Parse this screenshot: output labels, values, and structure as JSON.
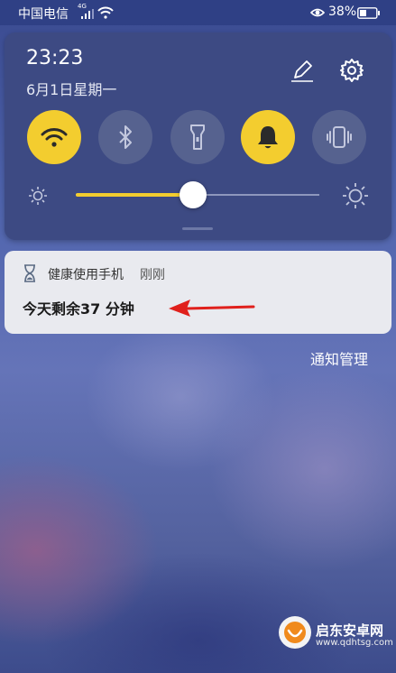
{
  "status_bar": {
    "carrier": "中国电信",
    "network_badge": "4G",
    "battery": "38%",
    "icons": [
      "signal-icon",
      "wifi-icon",
      "eye-comfort-icon",
      "battery-icon"
    ]
  },
  "quick_panel": {
    "time": "23:23",
    "date": "6月1日星期一",
    "toggles": [
      {
        "name": "wifi",
        "icon": "wifi-icon",
        "state": "on"
      },
      {
        "name": "bluetooth",
        "icon": "bluetooth-icon",
        "state": "off"
      },
      {
        "name": "flashlight",
        "icon": "flashlight-icon",
        "state": "off"
      },
      {
        "name": "sound",
        "icon": "bell-icon",
        "state": "on"
      },
      {
        "name": "vibrate",
        "icon": "vibrate-icon",
        "state": "off"
      }
    ],
    "brightness_level": 0.48,
    "accent_color": "#f3cd2f"
  },
  "notification": {
    "app_name": "健康使用手机",
    "time": "刚刚",
    "body": "今天剩余37 分钟",
    "icon": "hourglass-icon",
    "annotation_color": "#e0201c"
  },
  "notification_manage": "通知管理",
  "watermark": {
    "title": "启东安卓网",
    "url": "www.qdhtsg.com"
  }
}
